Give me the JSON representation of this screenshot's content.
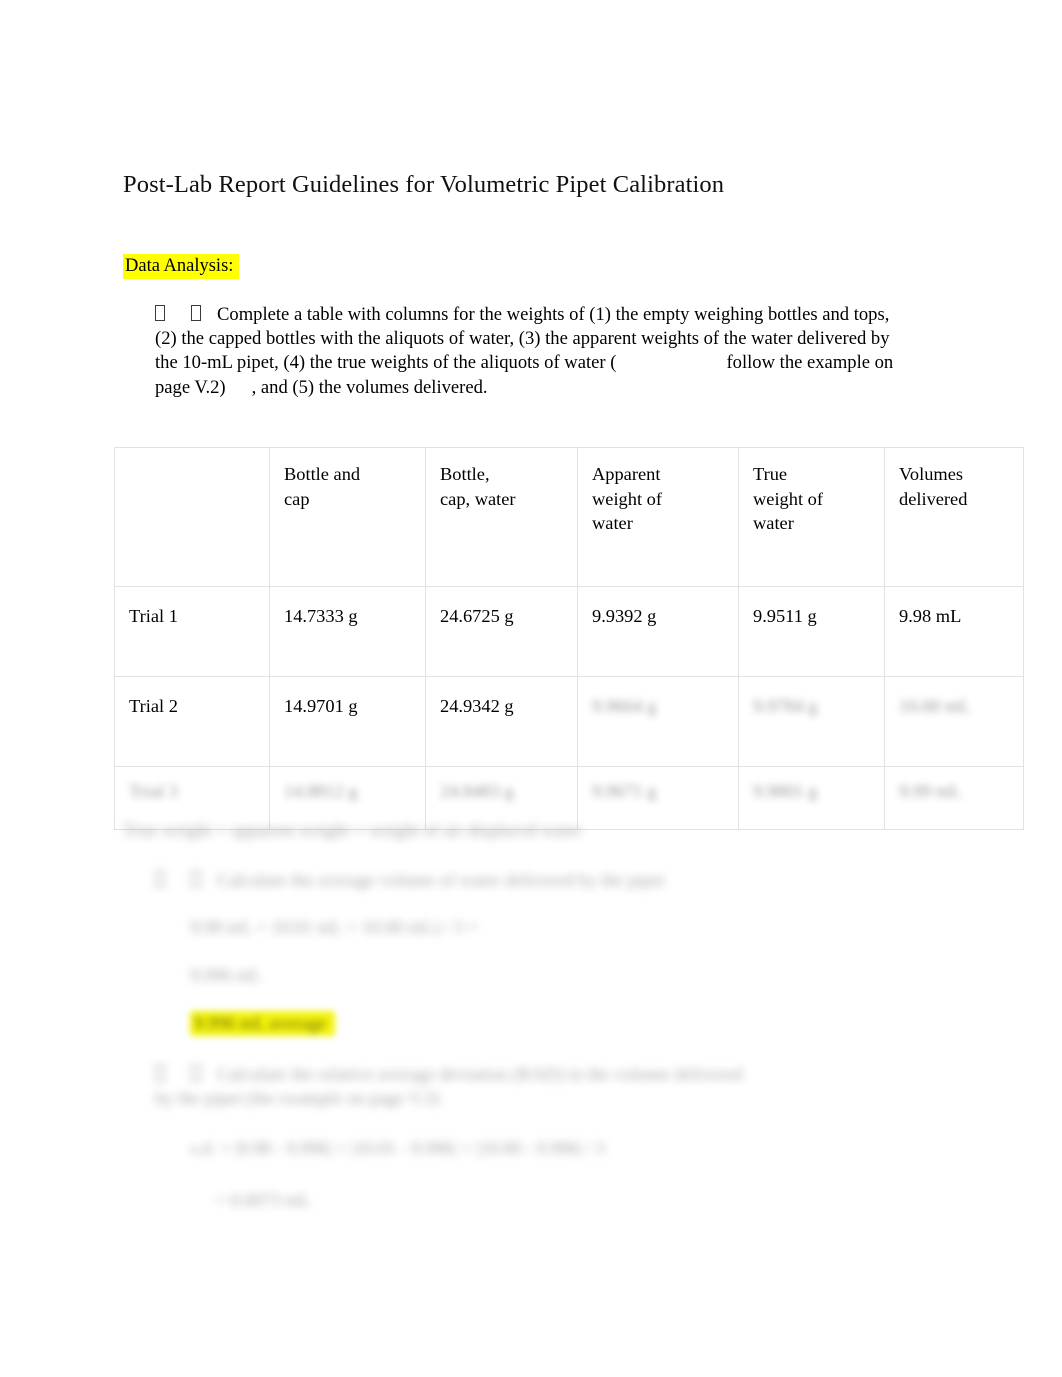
{
  "document": {
    "title": "Post-Lab Report Guidelines for Volumetric Pipet Calibration",
    "section_heading": "Data Analysis:",
    "bullet_1": "Complete a table with columns for the weights of (1) the empty weighing bottles and tops, (2) the capped bottles with the aliquots of water, (3) the apparent weights of the water delivered by the 10-mL pipet, (4) the true weights of the aliquots of water (",
    "bullet_1_part2": "follow the example on page V.2)",
    "bullet_1_part3": ", and (5) the volumes delivered."
  },
  "table": {
    "headers": [
      "",
      "Bottle and cap",
      "Bottle, cap, water",
      "Apparent weight of water",
      "True weight of water",
      "Volumes delivered"
    ],
    "header_lines": [
      [
        "",
        ""
      ],
      [
        "Bottle and",
        "cap"
      ],
      [
        "Bottle,",
        "cap, water"
      ],
      [
        "Apparent",
        "weight of",
        "water"
      ],
      [
        "True",
        "weight of",
        "water"
      ],
      [
        "Volumes",
        "delivered"
      ]
    ],
    "rows": [
      {
        "label": "Trial 1",
        "legible": true,
        "cells": [
          "14.7333 g",
          "24.6725 g",
          "9.9392 g",
          "9.9511 g",
          "9.98 mL"
        ]
      },
      {
        "label": "Trial 2",
        "legible": "partial",
        "cells": [
          "14.9701 g",
          "24.9342 g",
          "9.9664 g",
          "9.9784 g",
          "10.00 mL"
        ]
      },
      {
        "label": "Trial 3",
        "legible": false,
        "cells": [
          "14.8812 g",
          "24.8483 g",
          "9.9671 g",
          "9.9801 g",
          "9.99 mL"
        ]
      }
    ]
  },
  "notes": {
    "true_weight_formula": "True weight = apparent weight + weight of air displaced water",
    "bullet_2": "Calculate the average volume of water delivered by the pipet",
    "calc_line_1": "9.98 mL + 10.01 mL + 10.00 mL) / 3 =",
    "calc_line_2": "9.996 mL",
    "answer_highlighted": "9.996 mL average",
    "bullet_3": "Calculate the relative average deviation (RAD) in the volume delivered by the pipet (the example on page V.3)",
    "calc_line_3": "s.d. = |9.98 - 9.996| + |10.01 - 9.996| + |10.00 - 9.996| / 3",
    "calc_line_4": "= 0.0073 mL"
  },
  "colors": {
    "highlight": "#ffff00",
    "text": "#000000",
    "table_border": "#e2e2e2"
  }
}
